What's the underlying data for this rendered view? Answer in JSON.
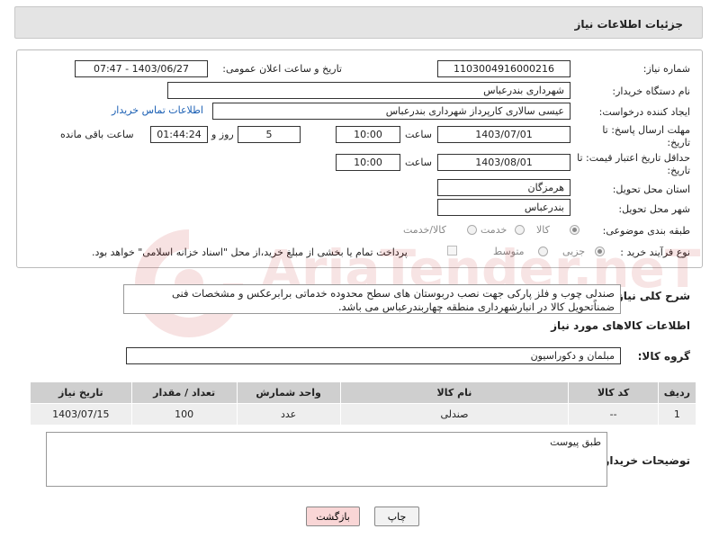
{
  "header": {
    "title": "جزئیات اطلاعات نیاز"
  },
  "form": {
    "need_number": {
      "label": "شماره نیاز:",
      "value": "1103004916000216"
    },
    "announce": {
      "label": "تاریخ و ساعت اعلان عمومی:",
      "value": "1403/06/27 - 07:47"
    },
    "buyer_org": {
      "label": "نام دستگاه خریدار:",
      "value": "شهرداری بندرعباس"
    },
    "creator": {
      "label": "ایجاد کننده درخواست:",
      "value": "عیسی سالاری کارپرداز شهرداری بندرعباس",
      "contact_link": "اطلاعات تماس خریدار"
    },
    "reply_deadline": {
      "label_line1": "مهلت ارسال پاسخ: تا",
      "label_line2": "تاریخ:",
      "date": "1403/07/01",
      "time_label": "ساعت",
      "time": "10:00",
      "days": "5",
      "days_label": "روز و",
      "remaining": "01:44:24",
      "remaining_label": "ساعت باقی مانده"
    },
    "price_validity": {
      "label_line1": "حداقل تاریخ اعتبار قیمت: تا",
      "label_line2": "تاریخ:",
      "date": "1403/08/01",
      "time_label": "ساعت",
      "time": "10:00"
    },
    "province": {
      "label": "استان محل تحویل:",
      "value": "هرمزگان"
    },
    "city": {
      "label": "شهر محل تحویل:",
      "value": "بندرعباس"
    },
    "category": {
      "label": "طبقه بندی موضوعی:",
      "options": [
        "کالا",
        "خدمت",
        "کالا/خدمت"
      ],
      "selected": "کالا"
    },
    "process": {
      "label": "نوع فرآیند خرید :",
      "options": [
        "جزیی",
        "متوسط"
      ],
      "selected": "جزیی",
      "payment_note": "پرداخت تمام یا بخشی از مبلغ خرید،از محل \"اسناد خزانه اسلامی\" خواهد بود."
    }
  },
  "description": {
    "label": "شرح کلی نیاز:",
    "text": "صندلی چوب و فلز پارکی جهت نصب دربوستان های سطح محدوده خدماتی برابرعکس و مشخصات فنی ضمناًتحویل کالا در انبارشهرداری منطقه چهاربندرعباس می باشد."
  },
  "goods": {
    "section_title": "اطلاعات کالاهای مورد نیاز",
    "group_label": "گروه کالا:",
    "group_value": "مبلمان و دکوراسیون",
    "columns": [
      "ردیف",
      "کد کالا",
      "نام کالا",
      "واحد شمارش",
      "تعداد / مقدار",
      "تاریخ نیاز"
    ],
    "rows": [
      {
        "index": "1",
        "code": "--",
        "name": "صندلی",
        "unit": "عدد",
        "qty": "100",
        "date": "1403/07/15"
      }
    ]
  },
  "buyer_notes": {
    "label": "توضیحات خریدار:",
    "text": "طبق پیوست"
  },
  "buttons": {
    "print": "چاپ",
    "back": "بازگشت"
  },
  "watermark": {
    "text": "AriaTender.neT"
  },
  "colors": {
    "link": "#1a5fb4",
    "back_button_bg": "#f9d6d6",
    "print_button_bg": "#f2f2f2",
    "table_header": "#cfcfcf"
  }
}
